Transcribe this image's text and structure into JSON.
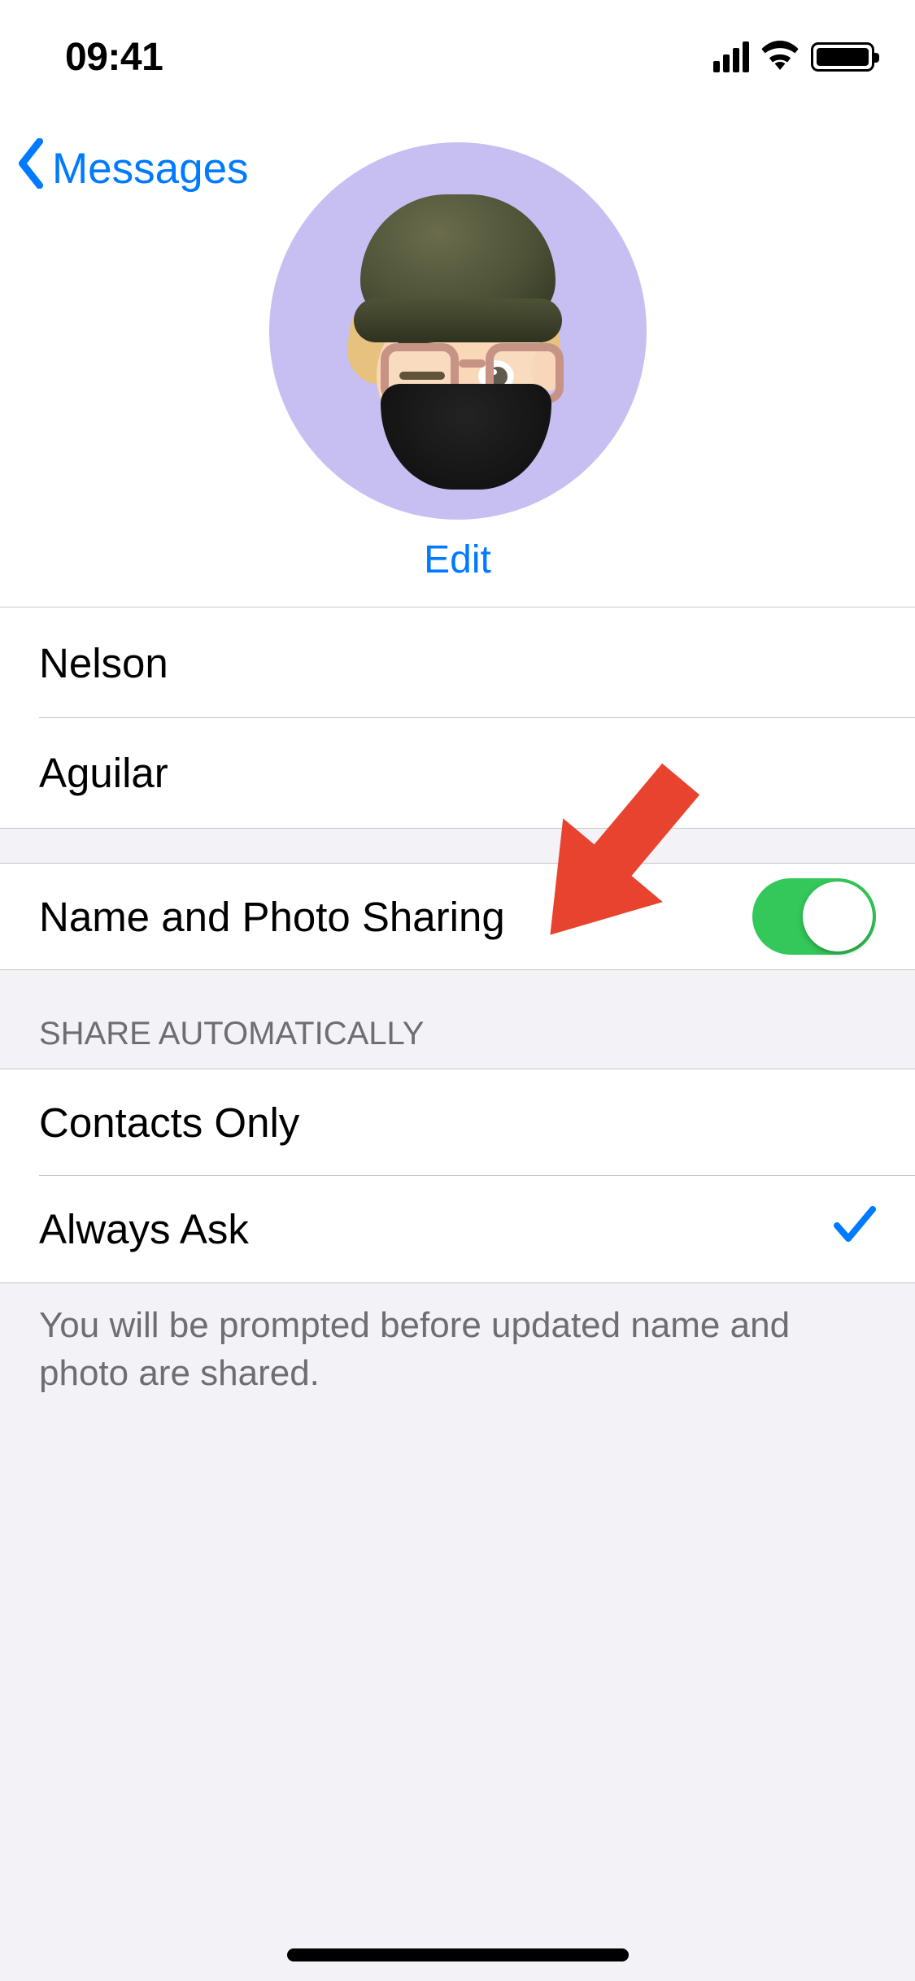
{
  "status": {
    "time": "09:41"
  },
  "nav": {
    "back_label": "Messages",
    "edit_label": "Edit"
  },
  "name_fields": {
    "first_name": "Nelson",
    "last_name": "Aguilar"
  },
  "sharing": {
    "row_label": "Name and Photo Sharing",
    "enabled": true
  },
  "share_automatically": {
    "header": "SHARE AUTOMATICALLY",
    "options": [
      {
        "label": "Contacts Only",
        "selected": false
      },
      {
        "label": "Always Ask",
        "selected": true
      }
    ],
    "footer": "You will be prompted before updated name and photo are shared."
  },
  "colors": {
    "tint": "#007aff",
    "toggle_on": "#34c759",
    "annotation": "#e8432f"
  }
}
